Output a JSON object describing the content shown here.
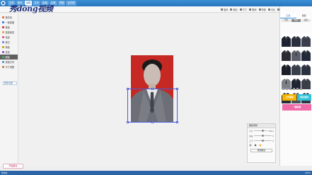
{
  "app": {
    "logo_text": "秀dōng视频"
  },
  "menu": {
    "items": [
      {
        "label": "文件",
        "active": false
      },
      {
        "label": "美化",
        "active": false
      },
      {
        "label": "抠图",
        "active": true
      },
      {
        "label": "文字",
        "active": false
      },
      {
        "label": "贴纸",
        "active": false
      },
      {
        "label": "边框",
        "active": false
      },
      {
        "label": "拼图",
        "active": false
      },
      {
        "label": "证件照",
        "active": false
      }
    ]
  },
  "toolbar": {
    "buttons": [
      "旋转",
      "裁剪",
      "尺寸",
      "撤销",
      "重做",
      "对比",
      "预览",
      "保存"
    ]
  },
  "left_panel": {
    "items": [
      {
        "label": "换背景",
        "icon": "background-icon",
        "color": "#e26b3a",
        "active": false
      },
      {
        "label": "一键抠图",
        "icon": "magic-icon",
        "color": "#3a7be2",
        "active": false
      },
      {
        "label": "换装",
        "icon": "suit-icon",
        "color": "#d0342c",
        "active": false
      },
      {
        "label": "智能美容",
        "icon": "beauty-icon",
        "color": "#e2a23a",
        "active": false
      },
      {
        "label": "祛痘",
        "icon": "acne-icon",
        "color": "#e04f87",
        "active": false
      },
      {
        "label": "美白",
        "icon": "whiten-icon",
        "color": "#7a7ae2",
        "active": false
      },
      {
        "label": "换装",
        "icon": "outfit-icon",
        "color": "#d6a000",
        "active": false
      },
      {
        "label": "发型",
        "icon": "hair-icon",
        "color": "#9a49c6",
        "active": false
      },
      {
        "label": "服装",
        "icon": "clothes-icon",
        "color": "#3fb06a",
        "active": true
      },
      {
        "label": "排版打印",
        "icon": "print-icon",
        "color": "#5b8bd6",
        "active": false
      },
      {
        "label": "尺寸调整",
        "icon": "resize-icon",
        "color": "#c47e3b",
        "active": false
      }
    ],
    "footer": "更多功能"
  },
  "adjust_panel": {
    "title": "服装调整",
    "rows": [
      {
        "label": "大小",
        "value": "100%"
      },
      {
        "label": "左右",
        "value": "0"
      },
      {
        "label": "上下",
        "value": "0"
      }
    ],
    "button": "删除服装"
  },
  "right_panel": {
    "tabs": [
      {
        "label": "正装",
        "active": true
      },
      {
        "label": "便装",
        "active": false
      }
    ],
    "subtabs": [
      {
        "label": "男装",
        "active": false
      },
      {
        "label": "女装",
        "active": true
      },
      {
        "label": "童装",
        "active": false
      }
    ],
    "banners": [
      {
        "label": "上传服装",
        "color": "#f5b400"
      },
      {
        "label": "更多素材",
        "color": "#33c3d8"
      },
      {
        "label": "一键换装",
        "color": "#f06aa8"
      }
    ],
    "suit_colors": [
      "#1d2233",
      "#2a2f3d",
      "#3b3f4d",
      "#2b2b33",
      "#5b5f6b",
      "#212a3a",
      "#1b1e28",
      "#38404d",
      "#2a3140",
      "#7d8088",
      "#1f2433",
      "#3a3f4a",
      "#262b36",
      "#4a4e59",
      "#2f3542"
    ]
  },
  "bottom": {
    "button": "开始美化",
    "status_left": "状态栏",
    "status_right": "100%"
  }
}
